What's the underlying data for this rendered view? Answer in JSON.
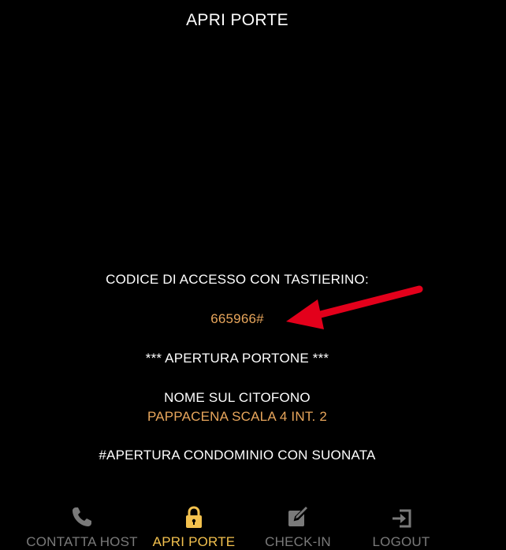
{
  "header": {
    "title": "APRI PORTE"
  },
  "content": {
    "access_code_heading": "CODICE DI ACCESSO CON TASTIERINO:",
    "access_code_value": "665966#",
    "gate_opening": "*** APERTURA PORTONE ***",
    "intercom_heading": "NOME SUL CITOFONO",
    "intercom_name": "PAPPACENA SCALA 4 INT. 2",
    "condo_opening": "#APERTURA CONDOMINIO CON SUONATA"
  },
  "tabs": [
    {
      "label": "CONTATTA HOST",
      "icon": "phone-icon",
      "active": false
    },
    {
      "label": "APRI PORTE",
      "icon": "lock-icon",
      "active": true
    },
    {
      "label": "CHECK-IN",
      "icon": "edit-icon",
      "active": false
    },
    {
      "label": "LOGOUT",
      "icon": "logout-icon",
      "active": false
    }
  ],
  "colors": {
    "background": "#000000",
    "text": "#ffffff",
    "accent_gold": "#e8a65c",
    "active_tab": "#f3c14e",
    "inactive_tab": "#7a7a7a",
    "annotation_arrow": "#e3001b"
  }
}
